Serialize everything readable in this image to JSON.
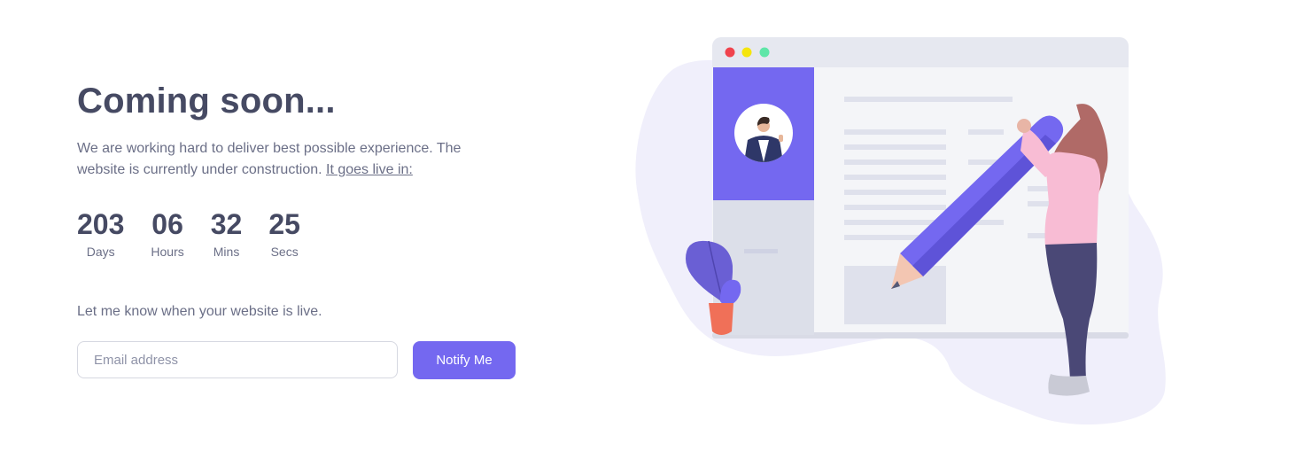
{
  "heading": "Coming soon...",
  "description": {
    "text": "We are working hard to deliver best possible experience. The website is currently under construction. ",
    "link": "It goes live in:"
  },
  "countdown": [
    {
      "value": "203",
      "label": "Days"
    },
    {
      "value": "06",
      "label": "Hours"
    },
    {
      "value": "32",
      "label": "Mins"
    },
    {
      "value": "25",
      "label": "Secs"
    }
  ],
  "subscribe": {
    "prompt": "Let me know when your website is live.",
    "email_placeholder": "Email address",
    "button_label": "Notify Me"
  },
  "colors": {
    "accent": "#7468f0",
    "heading": "#464a63",
    "body_text": "#6b6f87"
  },
  "illustration": {
    "icons": [
      "window-dots-icon",
      "avatar-icon",
      "pencil-icon",
      "plant-icon",
      "woman-figure-icon"
    ]
  }
}
